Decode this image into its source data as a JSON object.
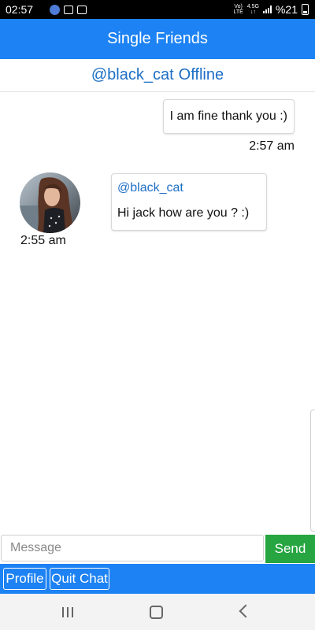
{
  "status_bar": {
    "time": "02:57",
    "signal_top": "Vo)",
    "signal_bottom": "LTE",
    "net_top": "4.5G",
    "net_bottom": "↓↑",
    "battery": "%21"
  },
  "header": {
    "title": "Single Friends"
  },
  "chat_header": {
    "username": "@black_cat",
    "status": "Offline"
  },
  "messages": [
    {
      "direction": "outgoing",
      "text": "I am fine thank you :)",
      "time": "2:57 am"
    },
    {
      "direction": "incoming",
      "sender": "@black_cat",
      "text": "Hi jack how are you ? :)",
      "time": "2:55 am"
    }
  ],
  "composer": {
    "placeholder": "Message",
    "value": "",
    "send_label": "Send"
  },
  "bottom_bar": {
    "profile_label": "Profile",
    "quit_label": "Quit Chat"
  },
  "colors": {
    "primary": "#1d82f3",
    "link": "#1d6fc6",
    "send": "#26a541"
  },
  "icons": {
    "status_left": [
      "app-notification-icon",
      "gallery-icon",
      "app-icon"
    ],
    "status_right": [
      "signal-bars-icon",
      "battery-icon"
    ],
    "nav": [
      "recent-apps-icon",
      "home-icon",
      "back-icon"
    ]
  }
}
